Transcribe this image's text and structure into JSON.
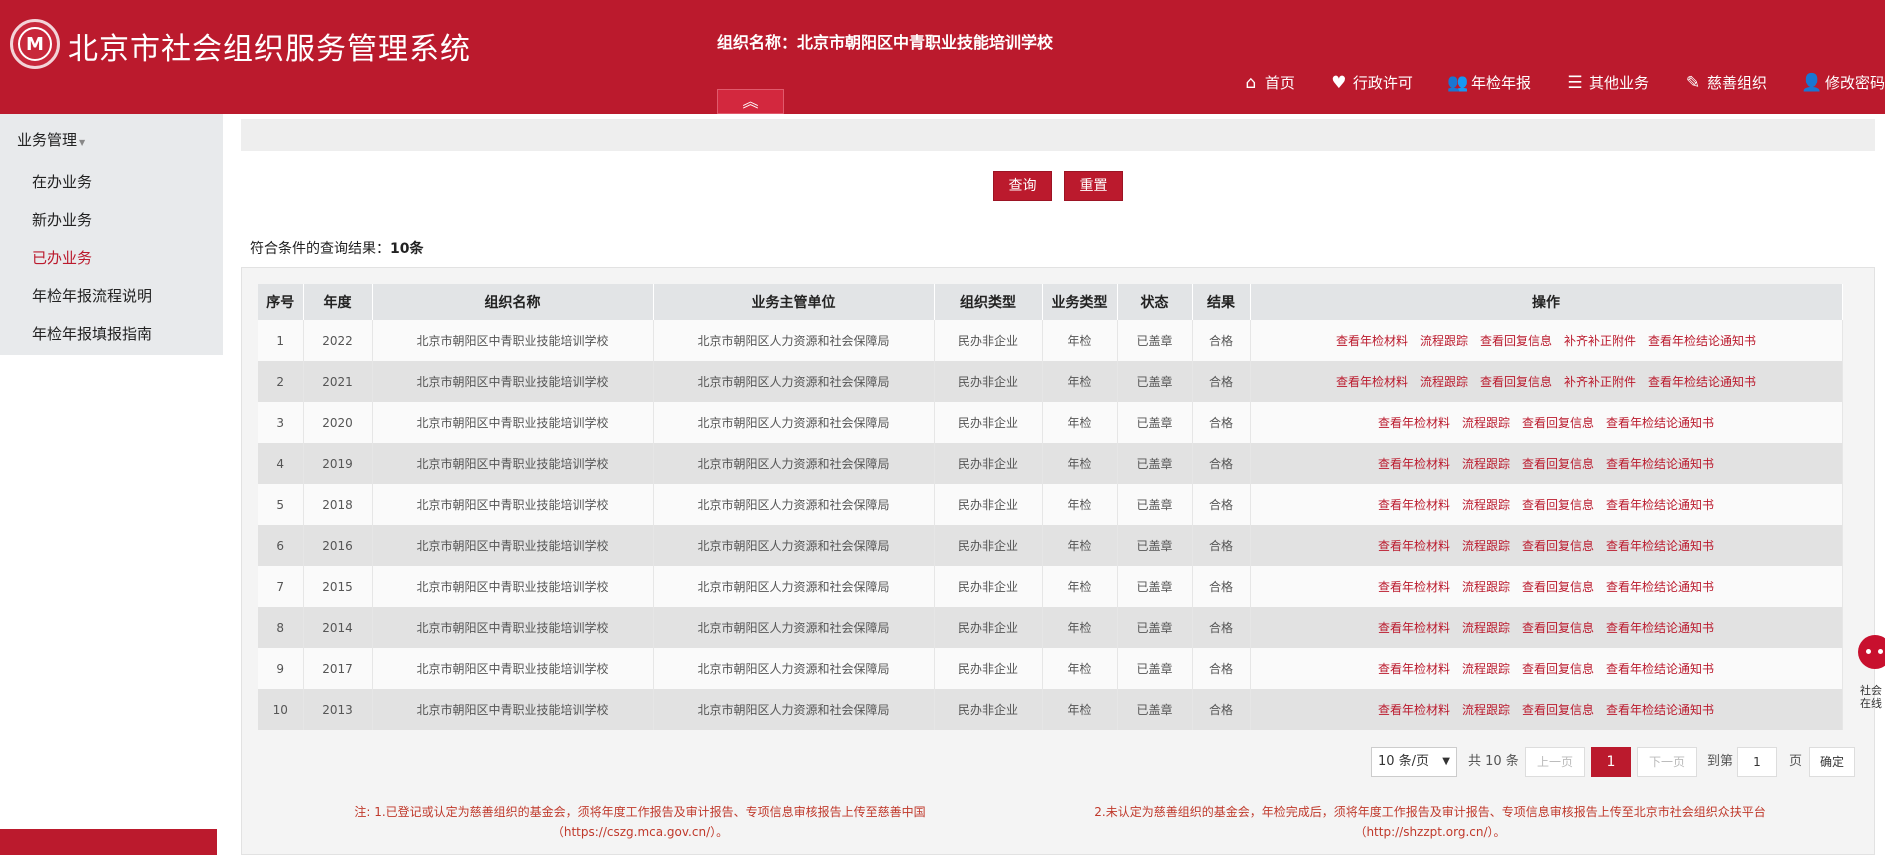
{
  "header": {
    "logo_text": "M",
    "title": "北京市社会组织服务管理系统",
    "org_name": "组织名称：北京市朝阳区中青职业技能培训学校",
    "collapse_icon": "chevron-up-double-icon",
    "collapse_glyph": "︽",
    "nav": [
      {
        "label": "首页",
        "icon": "home-icon",
        "glyph": "⌂"
      },
      {
        "label": "行政许可",
        "icon": "heart-icon",
        "glyph": "♥"
      },
      {
        "label": "年检年报",
        "icon": "users-icon",
        "glyph": "👥"
      },
      {
        "label": "其他业务",
        "icon": "list-icon",
        "glyph": "☰"
      },
      {
        "label": "慈善组织",
        "icon": "edit-icon",
        "glyph": "✎"
      },
      {
        "label": "修改密码",
        "icon": "user-icon",
        "glyph": "👤"
      }
    ]
  },
  "sidebar": {
    "heading": "业务管理",
    "items": [
      {
        "label": "在办业务",
        "active": false
      },
      {
        "label": "新办业务",
        "active": false
      },
      {
        "label": "已办业务",
        "active": true
      },
      {
        "label": "年检年报流程说明",
        "active": false
      },
      {
        "label": "年检年报填报指南",
        "active": false
      }
    ]
  },
  "search": {
    "query_label": "查询",
    "reset_label": "重置"
  },
  "result": {
    "prefix": "符合条件的查询结果：",
    "count": "10条"
  },
  "table": {
    "headers": [
      "序号",
      "年度",
      "组织名称",
      "业务主管单位",
      "组织类型",
      "业务类型",
      "状态",
      "结果",
      "操作"
    ],
    "rows": [
      {
        "no": "1",
        "year": "2022",
        "org": "北京市朝阳区中青职业技能培训学校",
        "dept": "北京市朝阳区人力资源和社会保障局",
        "type": "民办非企业",
        "biz": "年检",
        "status": "已盖章",
        "result": "合格",
        "ops": [
          "查看年检材料",
          "流程跟踪",
          "查看回复信息",
          "补齐补正附件",
          "查看年检结论通知书"
        ]
      },
      {
        "no": "2",
        "year": "2021",
        "org": "北京市朝阳区中青职业技能培训学校",
        "dept": "北京市朝阳区人力资源和社会保障局",
        "type": "民办非企业",
        "biz": "年检",
        "status": "已盖章",
        "result": "合格",
        "ops": [
          "查看年检材料",
          "流程跟踪",
          "查看回复信息",
          "补齐补正附件",
          "查看年检结论通知书"
        ]
      },
      {
        "no": "3",
        "year": "2020",
        "org": "北京市朝阳区中青职业技能培训学校",
        "dept": "北京市朝阳区人力资源和社会保障局",
        "type": "民办非企业",
        "biz": "年检",
        "status": "已盖章",
        "result": "合格",
        "ops": [
          "查看年检材料",
          "流程跟踪",
          "查看回复信息",
          "查看年检结论通知书"
        ]
      },
      {
        "no": "4",
        "year": "2019",
        "org": "北京市朝阳区中青职业技能培训学校",
        "dept": "北京市朝阳区人力资源和社会保障局",
        "type": "民办非企业",
        "biz": "年检",
        "status": "已盖章",
        "result": "合格",
        "ops": [
          "查看年检材料",
          "流程跟踪",
          "查看回复信息",
          "查看年检结论通知书"
        ]
      },
      {
        "no": "5",
        "year": "2018",
        "org": "北京市朝阳区中青职业技能培训学校",
        "dept": "北京市朝阳区人力资源和社会保障局",
        "type": "民办非企业",
        "biz": "年检",
        "status": "已盖章",
        "result": "合格",
        "ops": [
          "查看年检材料",
          "流程跟踪",
          "查看回复信息",
          "查看年检结论通知书"
        ]
      },
      {
        "no": "6",
        "year": "2016",
        "org": "北京市朝阳区中青职业技能培训学校",
        "dept": "北京市朝阳区人力资源和社会保障局",
        "type": "民办非企业",
        "biz": "年检",
        "status": "已盖章",
        "result": "合格",
        "ops": [
          "查看年检材料",
          "流程跟踪",
          "查看回复信息",
          "查看年检结论通知书"
        ]
      },
      {
        "no": "7",
        "year": "2015",
        "org": "北京市朝阳区中青职业技能培训学校",
        "dept": "北京市朝阳区人力资源和社会保障局",
        "type": "民办非企业",
        "biz": "年检",
        "status": "已盖章",
        "result": "合格",
        "ops": [
          "查看年检材料",
          "流程跟踪",
          "查看回复信息",
          "查看年检结论通知书"
        ]
      },
      {
        "no": "8",
        "year": "2014",
        "org": "北京市朝阳区中青职业技能培训学校",
        "dept": "北京市朝阳区人力资源和社会保障局",
        "type": "民办非企业",
        "biz": "年检",
        "status": "已盖章",
        "result": "合格",
        "ops": [
          "查看年检材料",
          "流程跟踪",
          "查看回复信息",
          "查看年检结论通知书"
        ]
      },
      {
        "no": "9",
        "year": "2017",
        "org": "北京市朝阳区中青职业技能培训学校",
        "dept": "北京市朝阳区人力资源和社会保障局",
        "type": "民办非企业",
        "biz": "年检",
        "status": "已盖章",
        "result": "合格",
        "ops": [
          "查看年检材料",
          "流程跟踪",
          "查看回复信息",
          "查看年检结论通知书"
        ]
      },
      {
        "no": "10",
        "year": "2013",
        "org": "北京市朝阳区中青职业技能培训学校",
        "dept": "北京市朝阳区人力资源和社会保障局",
        "type": "民办非企业",
        "biz": "年检",
        "status": "已盖章",
        "result": "合格",
        "ops": [
          "查看年检材料",
          "流程跟踪",
          "查看回复信息",
          "查看年检结论通知书"
        ]
      }
    ]
  },
  "pager": {
    "page_size": "10 条/页",
    "total": "共 10 条",
    "prev": "上一页",
    "current": "1",
    "next": "下一页",
    "goto": "到第",
    "goto_value": "1",
    "page_unit": "页",
    "confirm": "确定"
  },
  "notes": {
    "note1_line1": "注: 1.已登记或认定为慈善组织的基金会，须将年度工作报告及审计报告、专项信息审核报告上传至慈善中国",
    "note1_line2": "（https://cszg.mca.gov.cn/）。",
    "note2_line1": "2.未认定为慈善组织的基金会，年检完成后，须将年度工作报告及审计报告、专项信息审核报告上传至北京市社会组织众扶平台",
    "note2_line2": "（http://shzzpt.org.cn/）。"
  },
  "assistant": {
    "label_line1": "社会",
    "label_line2": "在线"
  },
  "colors": {
    "brand": "#bb1a2d",
    "link": "#bb1a2d"
  }
}
